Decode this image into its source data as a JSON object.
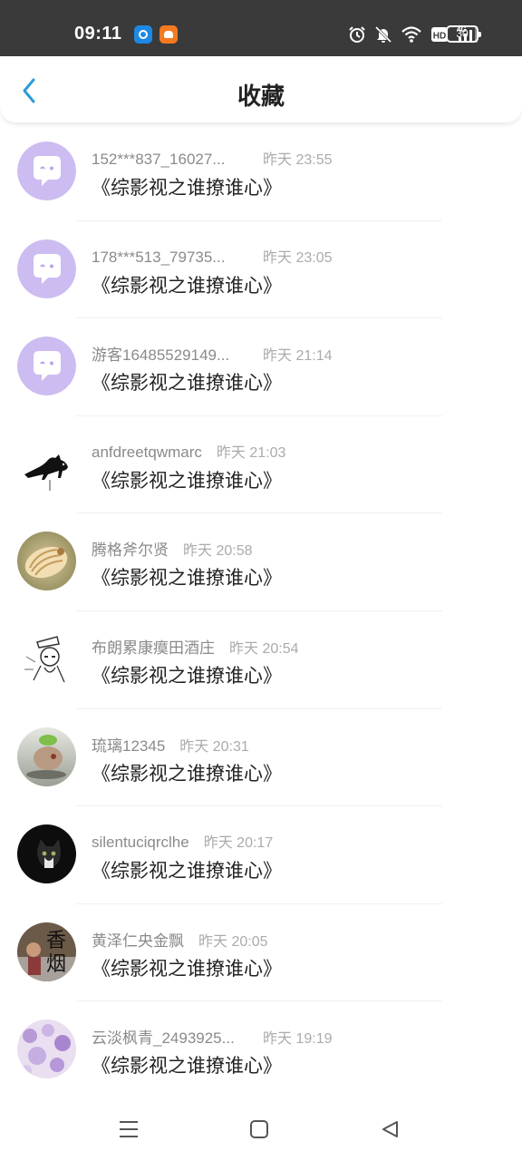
{
  "status_bar": {
    "time": "09:11",
    "battery": "30",
    "icons": [
      "alarm-icon",
      "mute-icon",
      "wifi-icon",
      "hd-icon",
      "4g-signal-icon"
    ]
  },
  "header": {
    "title": "收藏",
    "accent_color": "#2a9cd8"
  },
  "items": [
    {
      "user": "152***837_16027...",
      "time": "昨天 23:55",
      "book": "《综影视之谁撩谁心》",
      "avatar": "default-chat-avatar"
    },
    {
      "user": "178***513_79735...",
      "time": "昨天 23:05",
      "book": "《综影视之谁撩谁心》",
      "avatar": "default-chat-avatar"
    },
    {
      "user": "游客16485529149...",
      "time": "昨天 21:14",
      "book": "《综影视之谁撩谁心》",
      "avatar": "default-chat-avatar"
    },
    {
      "user": "anfdreetqwmarc",
      "time": "昨天 21:03",
      "book": "《综影视之谁撩谁心》",
      "avatar": "black-cat-avatar"
    },
    {
      "user": "腾格斧尔贤",
      "time": "昨天 20:58",
      "book": "《综影视之谁撩谁心》",
      "avatar": "seashell-avatar"
    },
    {
      "user": "布朗累康瘼田酒庄",
      "time": "昨天 20:54",
      "book": "《综影视之谁撩谁心》",
      "avatar": "sketch-character-avatar"
    },
    {
      "user": "琉璃12345",
      "time": "昨天 20:31",
      "book": "《综影视之谁撩谁心》",
      "avatar": "figurine-avatar"
    },
    {
      "user": "silentuciqrclhe",
      "time": "昨天 20:17",
      "book": "《综影视之谁撩谁心》",
      "avatar": "cat-photo-avatar"
    },
    {
      "user": "黄泽仁央金飘",
      "time": "昨天 20:05",
      "book": "《综影视之谁撩谁心》",
      "avatar": "text-photo-avatar",
      "avatar_text": "香烟"
    },
    {
      "user": "云淡枫青_2493925...",
      "time": "昨天 19:19",
      "book": "《综影视之谁撩谁心》",
      "avatar": "purple-flowers-avatar"
    }
  ],
  "nav_bar": {
    "buttons": [
      "menu-icon",
      "home-icon",
      "back-triangle-icon"
    ]
  }
}
